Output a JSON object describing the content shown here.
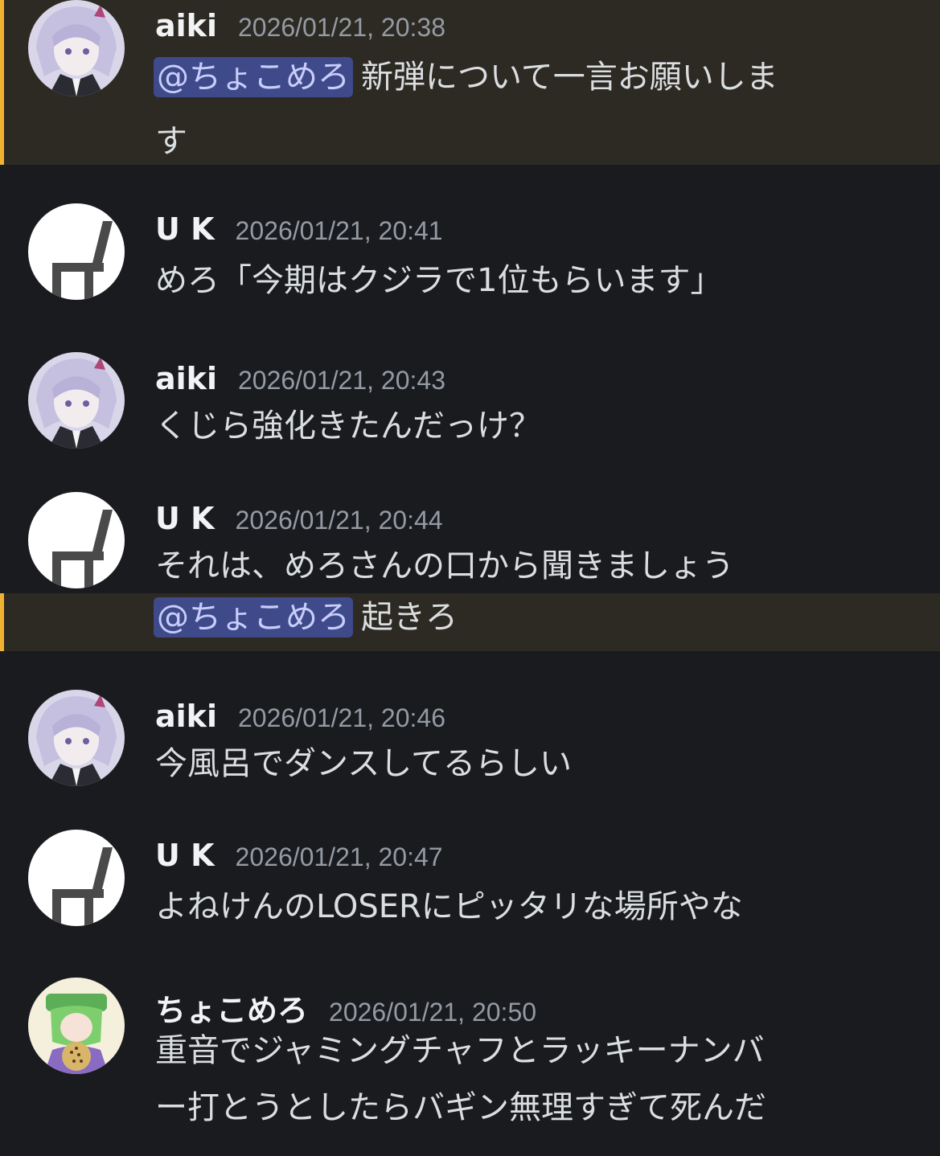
{
  "messages": [
    {
      "author": "aiki",
      "timestamp": "2026/01/21, 20:38",
      "avatar_icon": "anime-girl-avatar-icon",
      "highlighted": true,
      "lines": [
        {
          "mention": "@ちょこめろ",
          "text": "新弾について一言お願いしま"
        },
        {
          "text": "す"
        }
      ]
    },
    {
      "author": "U K",
      "timestamp": "2026/01/21, 20:41",
      "avatar_icon": "chair-avatar-icon",
      "lines": [
        {
          "text": "めろ「今期はクジラで1位もらいます」"
        }
      ]
    },
    {
      "author": "aiki",
      "timestamp": "2026/01/21, 20:43",
      "avatar_icon": "anime-girl-avatar-icon",
      "lines": [
        {
          "text": "くじら強化きたんだっけ？"
        }
      ]
    },
    {
      "author": "U K",
      "timestamp": "2026/01/21, 20:44",
      "avatar_icon": "chair-avatar-icon",
      "lines": [
        {
          "text": "それは、めろさんの口から聞きましょう"
        },
        {
          "mention": "@ちょこめろ",
          "text": "起きろ",
          "highlighted": true
        }
      ]
    },
    {
      "author": "aiki",
      "timestamp": "2026/01/21, 20:46",
      "avatar_icon": "anime-girl-avatar-icon",
      "lines": [
        {
          "text": "今風呂でダンスしてるらしい"
        }
      ]
    },
    {
      "author": "U K",
      "timestamp": "2026/01/21, 20:47",
      "avatar_icon": "chair-avatar-icon",
      "lines": [
        {
          "text": "よねけんのLOSERにピッタリな場所やな"
        }
      ]
    },
    {
      "author": "ちょこめろ",
      "timestamp": "2026/01/21, 20:50",
      "avatar_icon": "green-character-avatar-icon",
      "lines": [
        {
          "text": "重音でジャミングチャフとラッキーナンバ"
        },
        {
          "text": "ー打とうとしたらバギン無理すぎて死んだ"
        }
      ]
    }
  ],
  "colors": {
    "background": "#1a1b1f",
    "highlight_background": "#2d2a23",
    "highlight_bar": "#f0b232",
    "mention_background": "#3e4a8a",
    "mention_text": "#c9cdfb",
    "username": "#f2f3f5",
    "timestamp": "#949ba4",
    "message_text": "#dbdee1"
  }
}
